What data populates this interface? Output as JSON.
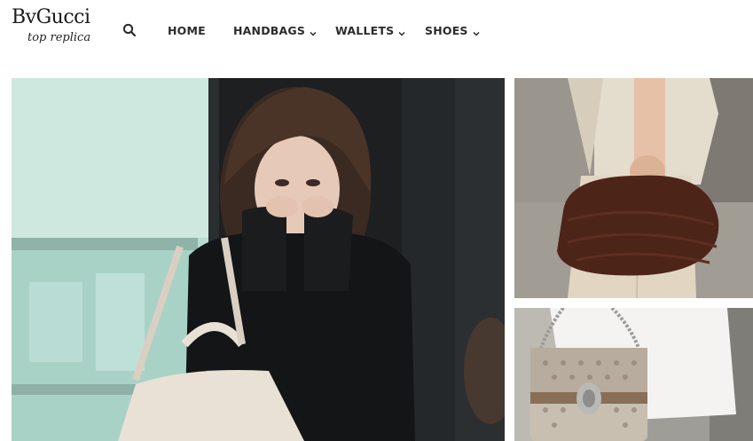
{
  "site": {
    "logo_main": "BvGucci",
    "logo_sub": "top replica"
  },
  "icons": {
    "search": "search-icon",
    "dropdown": "chevron-down-icon"
  },
  "nav": {
    "home": "HOME",
    "handbags": "HANDBAGS",
    "wallets": "WALLETS",
    "shoes": "SHOES"
  },
  "colors": {
    "text": "#2b2b2b",
    "background": "#ffffff"
  }
}
